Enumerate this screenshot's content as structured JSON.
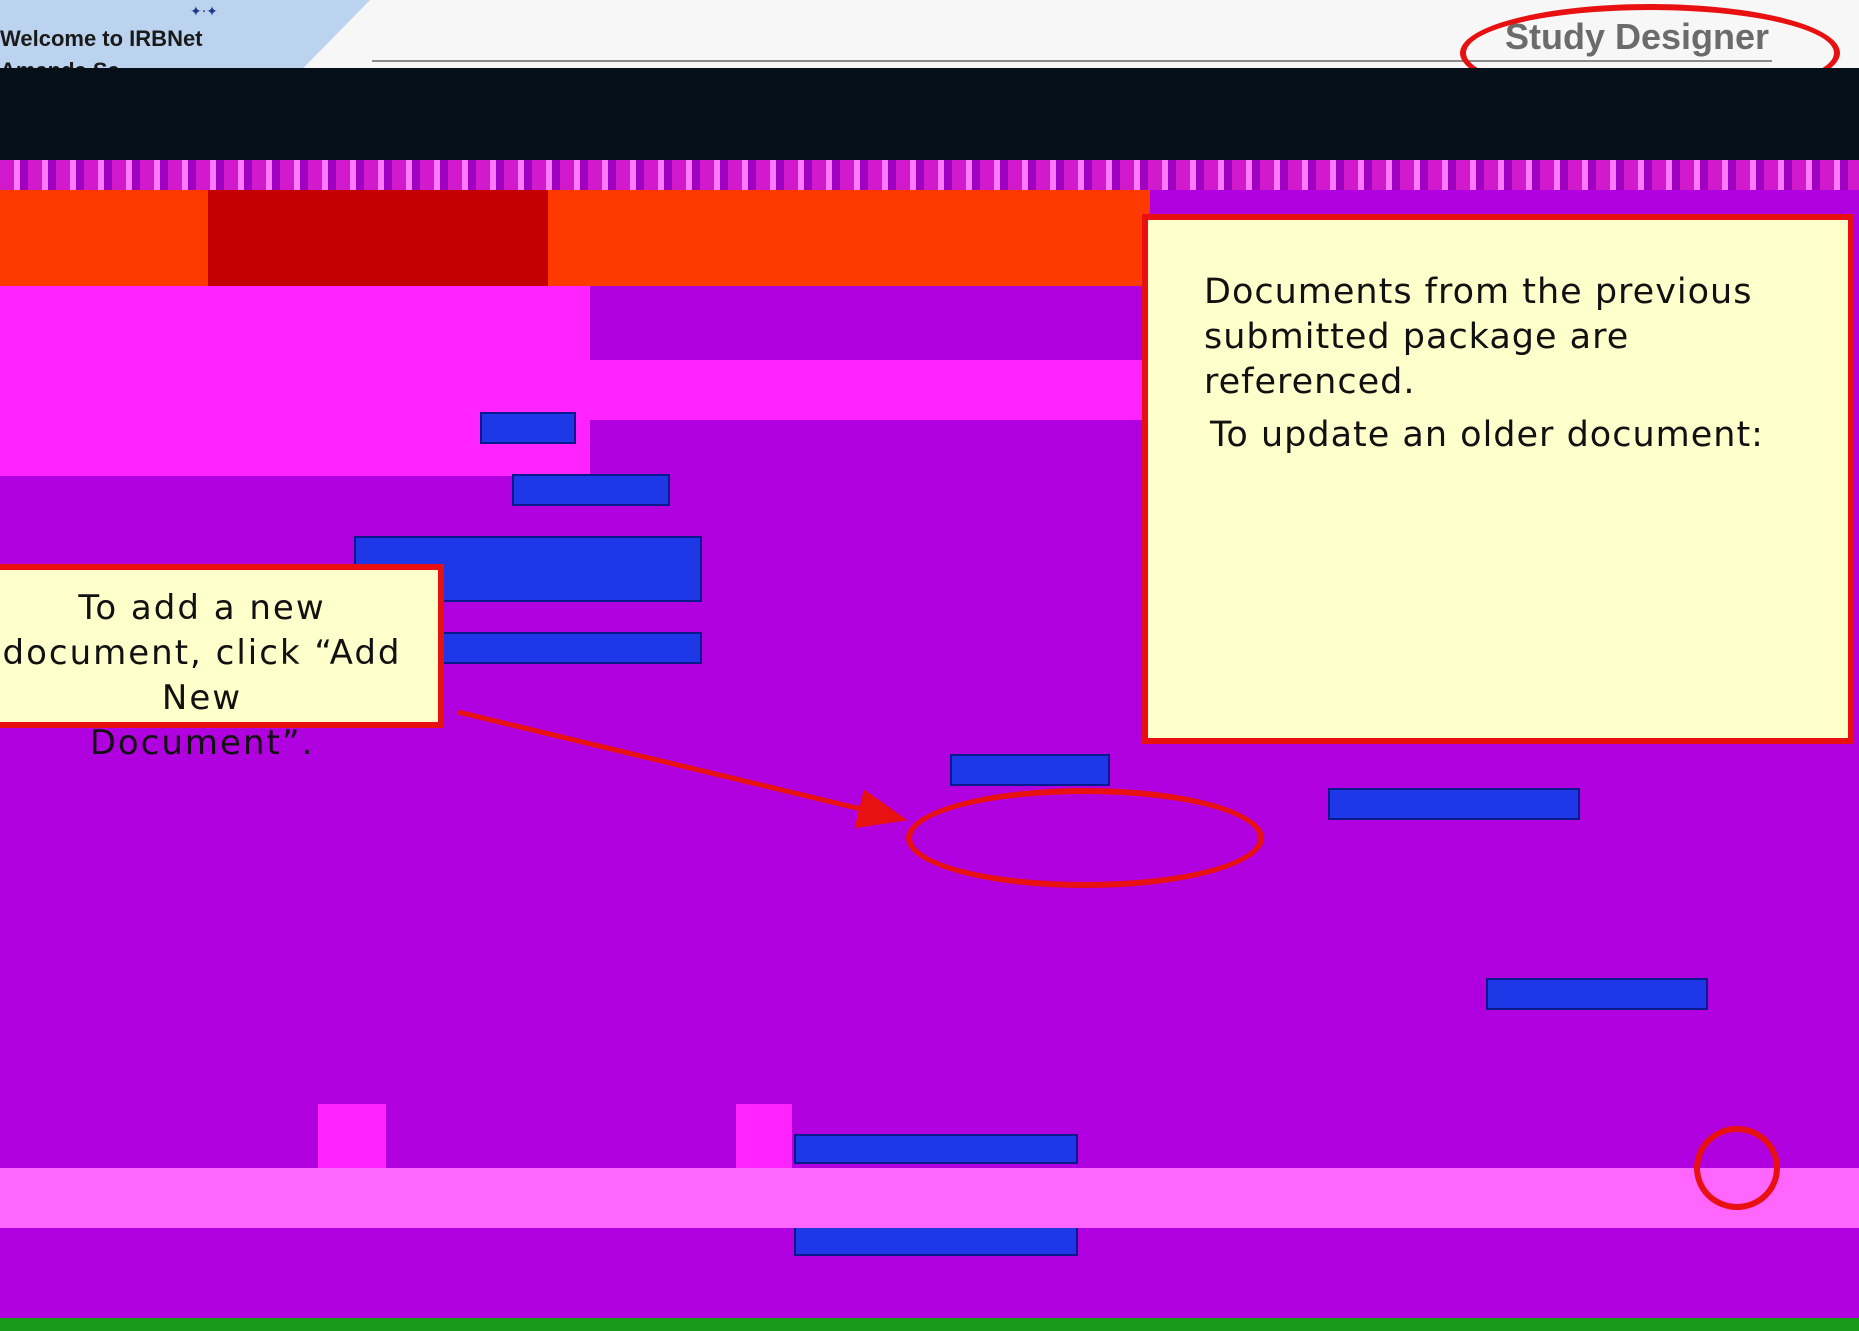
{
  "header": {
    "welcome_text": "Welcome to IRBNet",
    "user_name": "Amanda Sa",
    "role": "Study Designer"
  },
  "callouts": {
    "documents_lines": [
      "Documents from the previous",
      "submitted package are",
      "referenced."
    ],
    "update_step": "To update an older document:",
    "add_lines": [
      "To add a new",
      "document, click “Add New",
      "Document”."
    ]
  },
  "icons": {
    "logo": "irbnet-logo-icon"
  },
  "colors": {
    "highlight": "#e81010",
    "callout_background": "#ffffcc"
  }
}
